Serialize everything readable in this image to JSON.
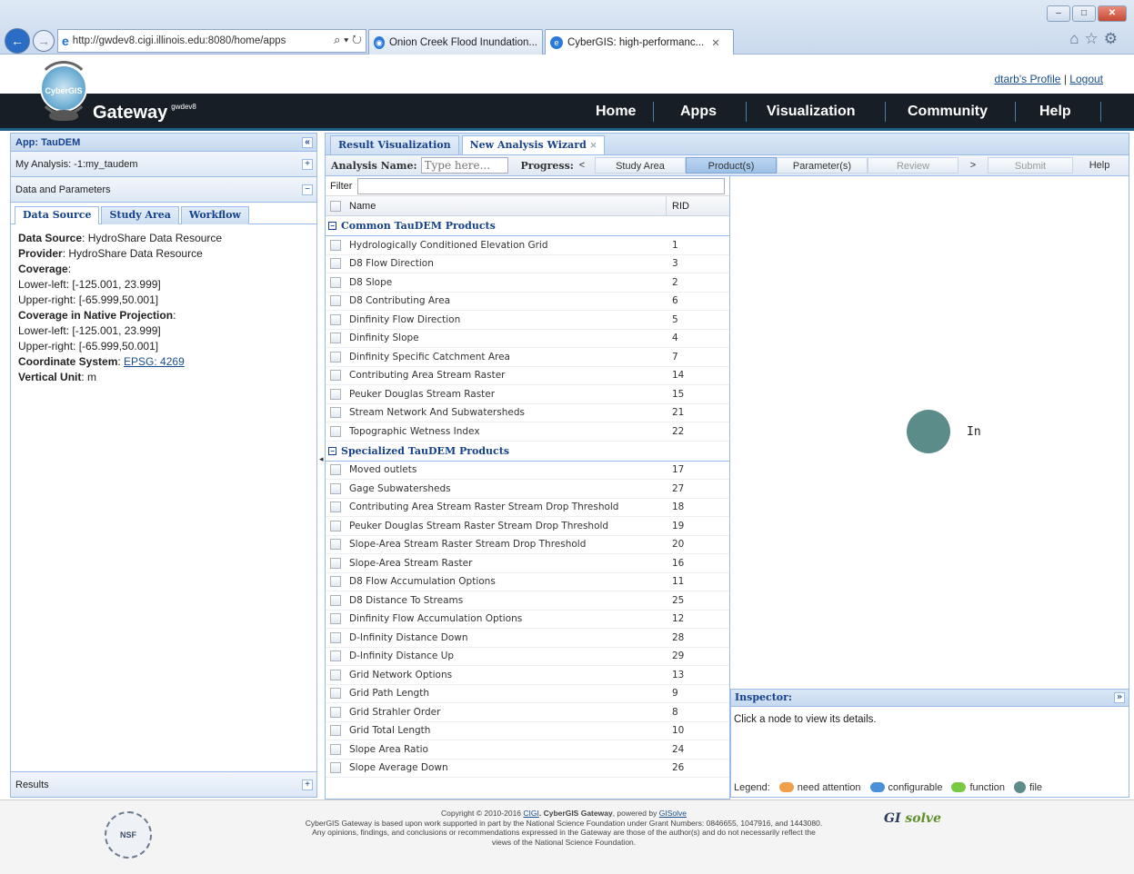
{
  "browser": {
    "url": "http://gwdev8.cigi.illinois.edu:8080/home/apps",
    "tabs": [
      {
        "label": "Onion Creek Flood Inundation..."
      },
      {
        "label": "CyberGIS: high-performanc..."
      }
    ]
  },
  "header": {
    "profile_link": "dtarb's Profile",
    "separator": "|",
    "logout_link": "Logout",
    "brand": "Gateway",
    "brand_sup": "gwdev8",
    "logo_text": "CyberGIS",
    "nav": [
      "Home",
      "Apps",
      "Visualization",
      "Community",
      "Help"
    ]
  },
  "left_panel": {
    "title": "App: TauDEM",
    "my_analysis": "My Analysis: -1:my_taudem",
    "data_params": "Data and Parameters",
    "tabs": [
      "Data Source",
      "Study Area",
      "Workflow"
    ],
    "info": {
      "ds_label": "Data Source",
      "ds_value": ": HydroShare Data Resource",
      "prov_label": "Provider",
      "prov_value": ": HydroShare Data Resource",
      "cov_label": "Coverage",
      "cov_suffix": ":",
      "cov_ll": "Lower-left: [-125.001, 23.999]",
      "cov_ur": "Upper-right: [-65.999,50.001]",
      "native_label": "Coverage in Native Projection",
      "native_suffix": ":",
      "native_ll": "Lower-left: [-125.001, 23.999]",
      "native_ur": "Upper-right: [-65.999,50.001]",
      "crs_label": "Coordinate System",
      "crs_sep": ": ",
      "crs_link": "EPSG: 4269",
      "vu_label": "Vertical Unit",
      "vu_value": ": m"
    },
    "results": "Results"
  },
  "main": {
    "tabs": [
      "Result Visualization",
      "New Analysis Wizard"
    ],
    "wizard": {
      "name_label": "Analysis Name:",
      "name_placeholder": "Type here...",
      "progress_label": "Progress:",
      "prev": "<",
      "steps": [
        "Study Area",
        "Product(s)",
        "Parameter(s)",
        "Review"
      ],
      "next": ">",
      "submit": "Submit",
      "help": "Help"
    },
    "filter_label": "Filter",
    "columns": {
      "name": "Name",
      "rid": "RID"
    },
    "groups": [
      {
        "title": "Common TauDEM Products",
        "items": [
          {
            "name": "Hydrologically Conditioned Elevation Grid",
            "rid": "1"
          },
          {
            "name": "D8 Flow Direction",
            "rid": "3"
          },
          {
            "name": "D8 Slope",
            "rid": "2"
          },
          {
            "name": "D8 Contributing Area",
            "rid": "6"
          },
          {
            "name": "Dinfinity Flow Direction",
            "rid": "5"
          },
          {
            "name": "Dinfinity Slope",
            "rid": "4"
          },
          {
            "name": "Dinfinity Specific Catchment Area",
            "rid": "7"
          },
          {
            "name": "Contributing Area Stream Raster",
            "rid": "14"
          },
          {
            "name": "Peuker Douglas Stream Raster",
            "rid": "15"
          },
          {
            "name": "Stream Network And Subwatersheds",
            "rid": "21"
          },
          {
            "name": "Topographic Wetness Index",
            "rid": "22"
          }
        ]
      },
      {
        "title": "Specialized TauDEM Products",
        "items": [
          {
            "name": "Moved outlets",
            "rid": "17"
          },
          {
            "name": "Gage Subwatersheds",
            "rid": "27"
          },
          {
            "name": "Contributing Area Stream Raster Stream Drop Threshold",
            "rid": "18"
          },
          {
            "name": "Peuker Douglas Stream Raster Stream Drop Threshold",
            "rid": "19"
          },
          {
            "name": "Slope-Area Stream Raster Stream Drop Threshold",
            "rid": "20"
          },
          {
            "name": "Slope-Area Stream Raster",
            "rid": "16"
          },
          {
            "name": "D8 Flow Accumulation Options",
            "rid": "11"
          },
          {
            "name": "D8 Distance To Streams",
            "rid": "25"
          },
          {
            "name": "Dinfinity Flow Accumulation Options",
            "rid": "12"
          },
          {
            "name": "D-Infinity Distance Down",
            "rid": "28"
          },
          {
            "name": "D-Infinity Distance Up",
            "rid": "29"
          },
          {
            "name": "Grid Network Options",
            "rid": "13"
          },
          {
            "name": "Grid Path Length",
            "rid": "9"
          },
          {
            "name": "Grid Strahler Order",
            "rid": "8"
          },
          {
            "name": "Grid Total Length",
            "rid": "10"
          },
          {
            "name": "Slope Area Ratio",
            "rid": "24"
          },
          {
            "name": "Slope Average Down",
            "rid": "26"
          }
        ]
      }
    ],
    "graph_node_label": "In",
    "inspector": {
      "title": "Inspector:",
      "body": "Click a node to view its details.",
      "legend_label": "Legend:",
      "legend": [
        {
          "label": "need attention",
          "color": "#f0a04b"
        },
        {
          "label": "configurable",
          "color": "#4a90d9"
        },
        {
          "label": "function",
          "color": "#7ac943"
        },
        {
          "label": "file",
          "color": "#5b8c8a"
        }
      ]
    }
  },
  "footer": {
    "nsf_logo": "NSF",
    "copyright": "Copyright © 2010-2016",
    "cigi": "CIGI",
    "cg_text": ". CyberGIS Gateway",
    "powered": ", powered by",
    "gisolve": "GISolve",
    "line2": "CyberGIS Gateway is based upon work supported in part by the National Science Foundation under Grant Numbers: 0846655, 1047916, and 1443080.",
    "line3": "Any opinions, findings, and conclusions or recommendations expressed in the Gateway are those of the author(s) and do not necessarily reflect the",
    "line4": "views of the National Science Foundation.",
    "gisolve_logo_a": "GI",
    "gisolve_logo_b": "solve"
  }
}
